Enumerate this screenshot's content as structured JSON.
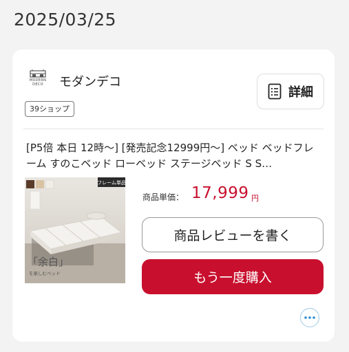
{
  "order_date": "2025/03/25",
  "shop": {
    "logo_text_line1": "MODERN",
    "logo_text_line2": "DECO",
    "name": "モダンデコ",
    "badge": "39ショップ",
    "detail_label": "詳細"
  },
  "product": {
    "title": "[P5倍 本日 12時～] [発売記念12999円～] ベッド ベッドフレーム すのこベッド ローベッド ステージベッド S S…",
    "thumb_tag": "フレーム単品",
    "thumb_caption_main": "「余白」",
    "thumb_caption_sub": "を楽しむベッド",
    "swatch_colors": [
      "#5a3b2a",
      "#d9c3a5",
      "#f1eee8"
    ],
    "price_label": "商品単価：",
    "price": "17,999",
    "price_unit": "円"
  },
  "actions": {
    "review_label": "商品レビューを書く",
    "rebuy_label": "もう一度購入"
  },
  "colors": {
    "accent": "#c8102e",
    "background": "#f3f3f3",
    "card": "#ffffff",
    "more_dots": "#2a8fd6"
  }
}
